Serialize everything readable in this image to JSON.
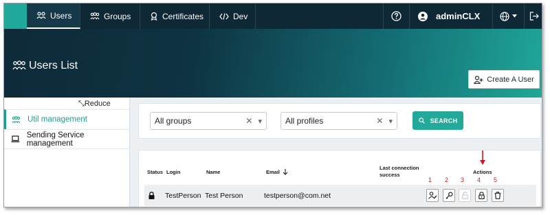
{
  "nav": {
    "tabs": [
      {
        "label": "Users",
        "icon": "users-icon",
        "active": true
      },
      {
        "label": "Groups",
        "icon": "groups-icon",
        "active": false
      },
      {
        "label": "Certificates",
        "icon": "certificate-icon",
        "active": false
      },
      {
        "label": "Dev",
        "icon": "code-icon",
        "active": false
      }
    ],
    "username": "adminCLX"
  },
  "header": {
    "title": "Users List",
    "create_button": "Create A User"
  },
  "sidebar": {
    "reduce_label": "Reduce",
    "items": [
      {
        "label": "Util management",
        "icon": "users-icon",
        "active": true
      },
      {
        "label": "Sending Service management",
        "icon": "laptop-icon",
        "active": false
      }
    ]
  },
  "filters": {
    "groups_value": "All groups",
    "profiles_value": "All profiles",
    "search_label": "SEARCH"
  },
  "table": {
    "headers": {
      "status": "Status",
      "login": "Login",
      "name": "Name",
      "email": "Email",
      "last_connection": "Last connection success",
      "actions": "Actions"
    },
    "rows": [
      {
        "status": "locked",
        "login": "TestPerson",
        "name": "Test Person",
        "email": "testperson@com.net",
        "last_connection": ""
      }
    ],
    "action_numbers": [
      "1",
      "2",
      "3",
      "4",
      "5"
    ]
  },
  "colors": {
    "accent": "#20a99b",
    "nav_bg": "#0e2836",
    "annotation": "#e0101a"
  }
}
